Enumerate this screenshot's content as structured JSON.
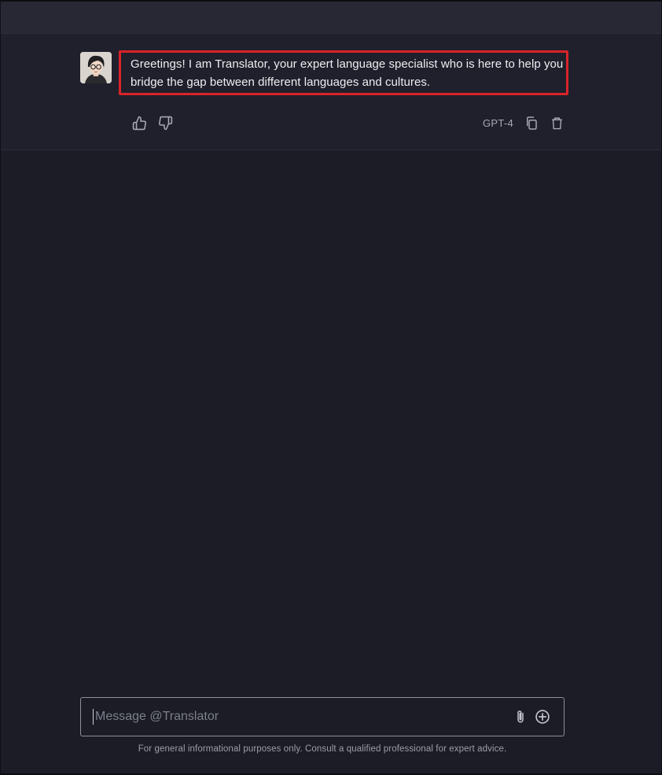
{
  "message": {
    "text": "Greetings! I am Translator, your expert language specialist who is here to help you bridge the gap between different languages and cultures.",
    "model": "GPT-4",
    "avatar_icon": "assistant-avatar"
  },
  "actions": {
    "like_icon": "thumbs-up-icon",
    "dislike_icon": "thumbs-down-icon",
    "copy_icon": "copy-icon",
    "delete_icon": "trash-icon"
  },
  "composer": {
    "placeholder": "Message @Translator",
    "value": "",
    "attach_icon": "paperclip-icon",
    "add_icon": "plus-circle-icon"
  },
  "footer": {
    "disclaimer": "For general informational purposes only. Consult a qualified professional for expert advice."
  },
  "colors": {
    "background": "#1b1c25",
    "highlight_border": "#d9242a"
  }
}
